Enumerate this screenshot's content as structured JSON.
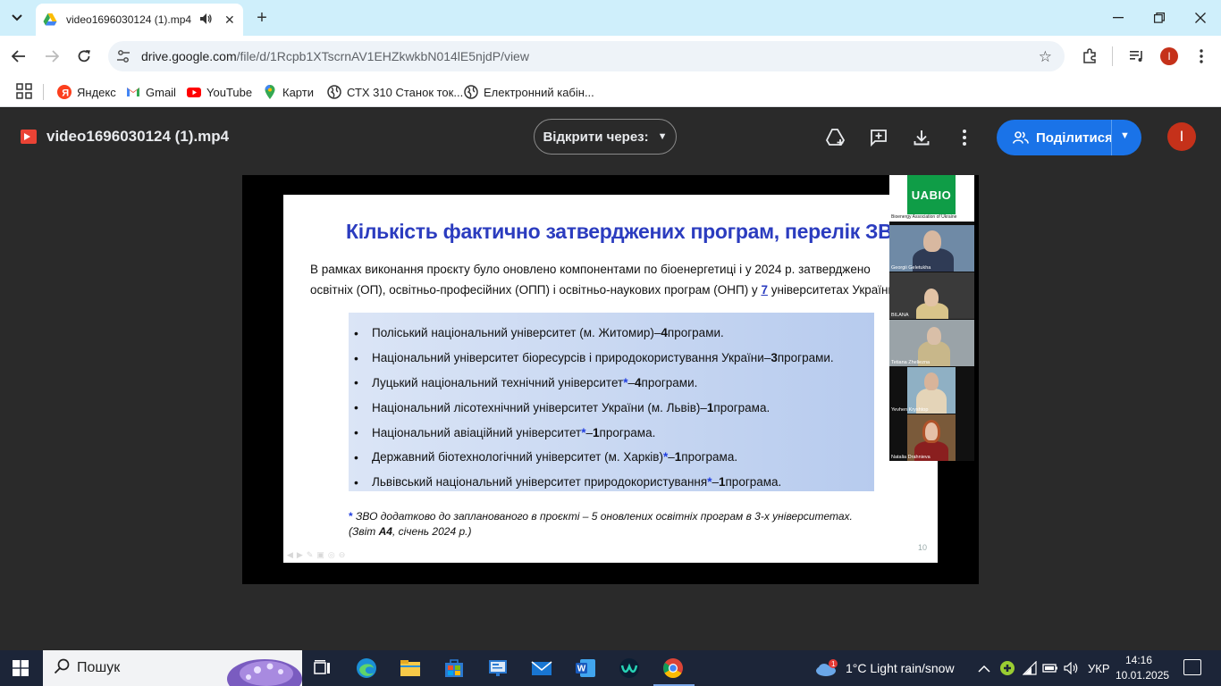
{
  "browser": {
    "tab_title": "video1696030124 (1).mp4 - Google Drive",
    "url_domain": "drive.google.com",
    "url_path": "/file/d/1Rcpb1XTscrnAV1EHZkwkbN014lE5njdP/view",
    "bookmarks": [
      {
        "label": "Яндекс",
        "icon": "yandex-icon",
        "color": "#fc3f1d"
      },
      {
        "label": "Gmail",
        "icon": "gmail-icon",
        "color": "#ea4335"
      },
      {
        "label": "YouTube",
        "icon": "youtube-icon",
        "color": "#ff0000"
      },
      {
        "label": "Карти",
        "icon": "maps-icon",
        "color": "#34a853"
      },
      {
        "label": "СТХ 310 Станок ток...",
        "icon": "globe-icon",
        "color": "#333333"
      },
      {
        "label": "Електронний кабін...",
        "icon": "globe-icon",
        "color": "#333333"
      }
    ],
    "profile_initial": "I"
  },
  "viewer": {
    "file_name": "video1696030124 (1).mp4",
    "open_with_label": "Відкрити через:",
    "share_label": "Поділитися",
    "profile_initial": "I"
  },
  "slide": {
    "title": "Кількість фактично затверджених програм, перелік ЗВО",
    "intro_line1": "В рамках виконання проєкту було оновлено компонентами по біоенергетиці і у 2024 р. затверджено",
    "intro_line2_pre": "освітніх (ОП), освітньо-професійних (ОПП) і освітньо-наукових програм (ОНП) у ",
    "intro_line2_num": "7",
    "intro_line2_post": " університетах України",
    "universities": [
      {
        "name": "Поліський національний університет (м. Житомир)",
        "asterisk": "",
        "dash": " – ",
        "count": "4",
        "unit": " програми."
      },
      {
        "name": "Національний університет біоресурсів і природокористування України",
        "asterisk": "",
        "dash": " – ",
        "count": "3",
        "unit": " програми."
      },
      {
        "name": "Луцький національний технічний університет",
        "asterisk": "*",
        "dash": " – ",
        "count": "4",
        "unit": " програми."
      },
      {
        "name": "Національний лісотехнічний університет України (м. Львів)",
        "asterisk": "",
        "dash": " – ",
        "count": "1",
        "unit": " програма."
      },
      {
        "name": "Національний авіаційний університет",
        "asterisk": "*",
        "dash": " – ",
        "count": "1",
        "unit": " програма."
      },
      {
        "name": "Державний біотехнологічний університет (м. Харків)",
        "asterisk": "*",
        "dash": " – ",
        "count": "1",
        "unit": " програма."
      },
      {
        "name": "Львівський національний університет природокористування",
        "asterisk": "*",
        "dash": " – ",
        "count": "1",
        "unit": " програма."
      }
    ],
    "footnote_line1": " ЗВО додатково до запланованого в проєкті – 5 оновлених освітніх програм в 3-х університетах.",
    "footnote_line2_pre": "(Звіт ",
    "footnote_line2_bold": "А4",
    "footnote_line2_post": ", січень 2024 р.)",
    "page_number": "10"
  },
  "participants": {
    "logo_text": "UABIO",
    "logo_subtitle": "Bioenergy Association of Ukraine",
    "people": [
      {
        "name": "Georgii Geletukha",
        "bg": "#6f8aa6",
        "skin": "#d8b8a0",
        "shirt": "#2f3b55"
      },
      {
        "name": "BILANA",
        "bg": "#3a3a3a",
        "skin": "#e2c3a5",
        "shirt": "#d9c48a"
      },
      {
        "name": "Tetiana Zheliezna",
        "bg": "#9aa3a8",
        "skin": "#d9bfa8",
        "shirt": "#c8b78a"
      },
      {
        "name": "Yevhen Kryshtop",
        "bg": "#8fb0c4",
        "skin": "#d8b49a",
        "shirt": "#e4d4b8"
      },
      {
        "name": "Natalia Drahnieva",
        "bg": "#7a5a3a",
        "skin": "#e6c0a8",
        "shirt": "#8a1f1f"
      }
    ]
  },
  "taskbar": {
    "search_label": "Пошук",
    "weather": "1°C  Light rain/snow",
    "weather_badge": "1",
    "language": "УКР",
    "time": "14:16",
    "date": "10.01.2025"
  }
}
